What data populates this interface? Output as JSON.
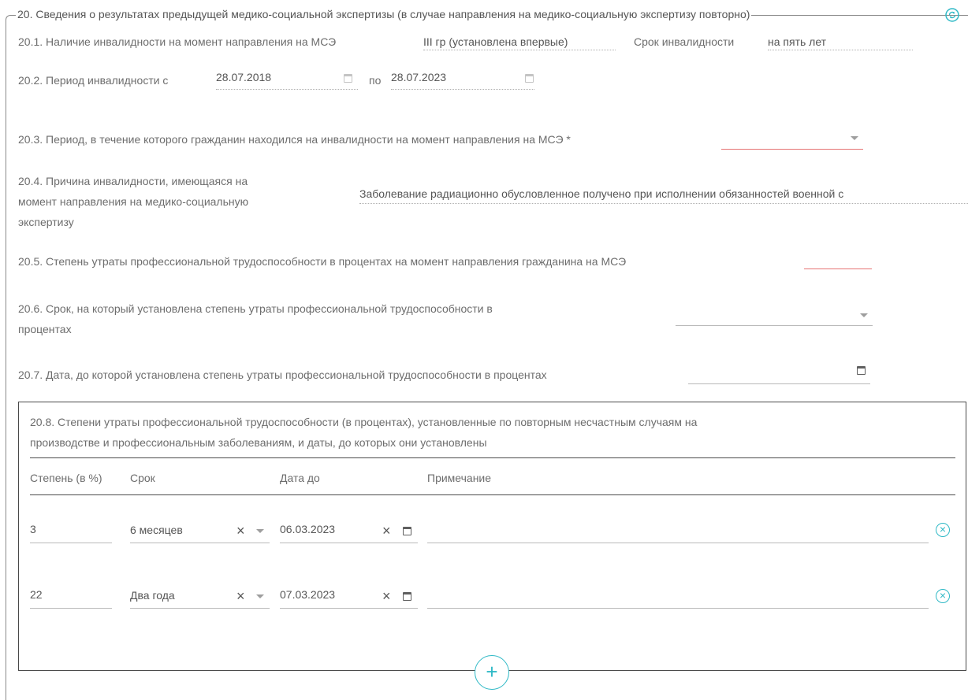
{
  "section": {
    "title": "20. Сведения о результатах предыдущей медико-социальной экспертизы (в случае направления на медико-социальную экспертизу повторно)",
    "refresh_icon": "refresh-icon"
  },
  "f20_1": {
    "label": "20.1. Наличие инвалидности на момент направления на МСЭ",
    "value": "III гр (установлена впервые)",
    "term_label": "Срок инвалидности",
    "term_value": "на пять лет"
  },
  "f20_2": {
    "label": "20.2. Период инвалидности с",
    "from": "28.07.2018",
    "to_label": "по",
    "to": "28.07.2023"
  },
  "f20_3": {
    "label": "20.3. Период, в течение которого гражданин находился на инвалидности на момент направления на МСЭ *",
    "value": ""
  },
  "f20_4": {
    "label_line1": "20.4. Причина инвалидности, имеющаяся на",
    "label_line2": "момент направления на медико-социальную",
    "label_line3": "экспертизу",
    "value": "Заболевание радиационно обусловленное получено при исполнении обязанностей военной с"
  },
  "f20_5": {
    "label": "20.5. Степень утраты профессиональной трудоспособности в процентах на момент направления гражданина на МСЭ",
    "value": ""
  },
  "f20_6": {
    "label_line1": "20.6. Срок, на который установлена степень утраты профессиональной трудоспособности в",
    "label_line2": "процентах",
    "value": ""
  },
  "f20_7": {
    "label": "20.7. Дата, до которой установлена степень утраты профессиональной трудоспособности в процентах",
    "value": ""
  },
  "f20_8": {
    "title_line1": "20.8. Степени утраты профессиональной трудоспособности (в процентах), установленные по повторным несчастным случаям на",
    "title_line2": "производстве и профессиональным заболеваниям, и даты, до которых они установлены",
    "columns": [
      "Степень (в %)",
      "Срок",
      "Дата до",
      "Примечание"
    ],
    "rows": [
      {
        "degree": "3",
        "term": "6 месяцев",
        "date": "06.03.2023",
        "note": ""
      },
      {
        "degree": "22",
        "term": "Два года",
        "date": "07.03.2023",
        "note": ""
      }
    ],
    "clear_glyph": "×",
    "add_glyph": "+",
    "remove_glyph": "×"
  }
}
